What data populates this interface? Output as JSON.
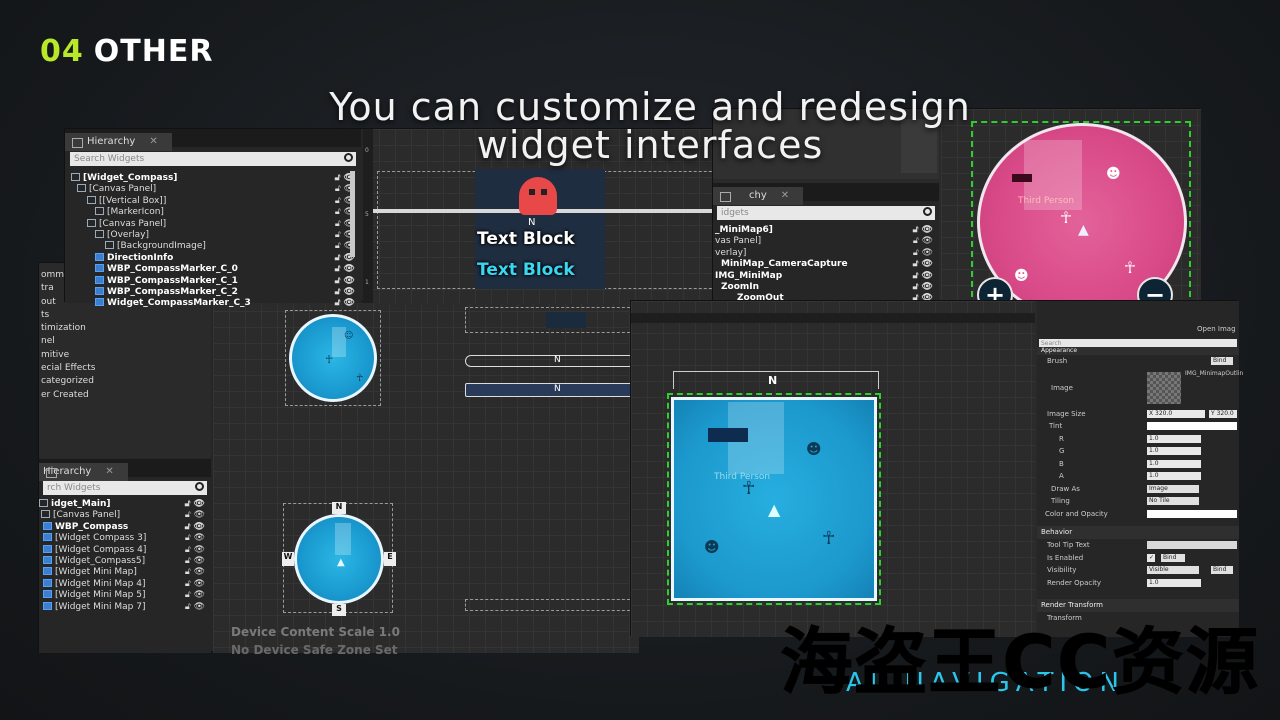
{
  "section": {
    "number": "04",
    "label": "OTHER"
  },
  "headline": {
    "line1": "You can customize and redesign",
    "line2": "widget interfaces"
  },
  "hier_top": {
    "tab": "Hierarchy",
    "search_placeholder": "Search Widgets",
    "items": [
      "[Widget_Compass]",
      "[Canvas Panel]",
      "[[Vertical Box]]",
      "[MarkerIcon]",
      "[Canvas Panel]",
      "[Overlay]",
      "[BackgroundImage]",
      "DirectionInfo",
      "WBP_CompassMarker_C_0",
      "WBP_CompassMarker_C_1",
      "WBP_CompassMarker_C_2",
      "Widget_CompassMarker_C_3"
    ]
  },
  "palette_categories": [
    "ommon",
    "tra",
    "out",
    "ts",
    "timization",
    "nel",
    "mitive",
    "ecial Effects",
    "categorized",
    "er Created"
  ],
  "hier_left": {
    "tab": "Hierarchy",
    "search_placeholder": "rch Widgets",
    "items": [
      "idget_Main]",
      "[Canvas Panel]",
      "WBP_Compass",
      "[Widget Compass 3]",
      "[Widget Compass 4]",
      "[Widget_Compass5]",
      "[Widget Mini Map]",
      "[Widget Mini Map 4]",
      "[Widget Mini Map 5]",
      "[Widget Mini Map 7]"
    ]
  },
  "preview": {
    "text_block_1": "Text Block",
    "text_block_2": "Text Block",
    "compass_letter": "N",
    "ruler_0": "0",
    "ruler_5": "5",
    "ruler_1": "1"
  },
  "hier_mini": {
    "tab": "chy",
    "search_placeholder": "idgets",
    "items": [
      "_MiniMap6]",
      "vas Panel]",
      "verlay]",
      "MiniMap_CameraCapture",
      "IMG_MiniMap",
      "ZoomIn",
      "ZoomOut"
    ]
  },
  "minimap_pink": {
    "label": "Third Person",
    "zoom_in": "+",
    "zoom_out": "−"
  },
  "minimap_blue": {
    "label": "Third Person",
    "north": "N"
  },
  "compass_small": {
    "n": "N",
    "s": "S",
    "e": "E",
    "w": "W"
  },
  "designer_footer": {
    "scale": "Device Content Scale 1.0",
    "safe_zone": "No Device Safe Zone Set"
  },
  "details": {
    "open_image": "Open Imag",
    "search": "Search",
    "appearance": "Appearance",
    "brush": "Brush",
    "bind": "Bind",
    "image": "Image",
    "image_name": "IMG_MinimapOutlin",
    "image_size": "Image Size",
    "size_x": "X 320.0",
    "size_y": "Y 320.0",
    "tint": "Tint",
    "r": "R",
    "g": "G",
    "b": "B",
    "a": "A",
    "r_val": "1.0",
    "g_val": "1.0",
    "b_val": "1.0",
    "a_val": "1.0",
    "draw_as": "Draw As",
    "draw_as_val": "Image",
    "tiling": "Tiling",
    "tiling_val": "No Tile",
    "color_opacity": "Color and Opacity",
    "behavior": "Behavior",
    "tool_tip": "Tool Tip Text",
    "is_enabled": "Is Enabled",
    "visibility": "Visibility",
    "visibility_val": "Visible",
    "render_opacity": "Render Opacity",
    "render_opacity_val": "1.0",
    "render_transform": "Render Transform",
    "transform": "Transform"
  },
  "brand": "AL NAVIGATION",
  "watermark": "海盗王CC资源",
  "colors": {
    "accent": "#b8e82a",
    "cyan": "#2bb6e4",
    "pink": "#d94a88",
    "selection": "#2cd02c"
  }
}
